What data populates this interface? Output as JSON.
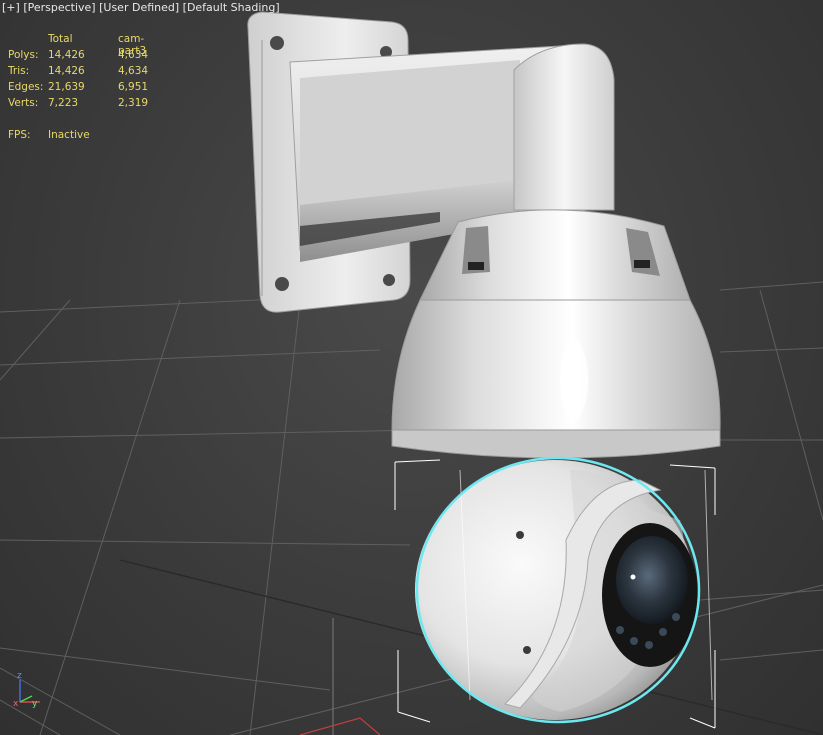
{
  "viewport": {
    "label_plus": "[+]",
    "label_view": "[Perspective]",
    "label_camera": "[User Defined]",
    "label_shading": "[Default Shading]",
    "background_color": "#3c3c3c",
    "grid_color": "#6a6a6a",
    "selection_color": "#6ee8f0"
  },
  "stats": {
    "header_total": "Total",
    "header_object": "cam-part3",
    "rows": [
      {
        "label": "Polys:",
        "total": "14,426",
        "object": "4,634"
      },
      {
        "label": "Tris:",
        "total": "14,426",
        "object": "4,634"
      },
      {
        "label": "Edges:",
        "total": "21,639",
        "object": "6,951"
      },
      {
        "label": "Verts:",
        "total": "7,223",
        "object": "2,319"
      }
    ],
    "fps_label": "FPS:",
    "fps_value": "Inactive",
    "text_color": "#e8d86a"
  },
  "gizmo": {
    "z_label": "z",
    "x_label": "x",
    "y_label": "y"
  },
  "scene": {
    "model_name": "cam-part3",
    "model_color": "#e6e6e6"
  }
}
